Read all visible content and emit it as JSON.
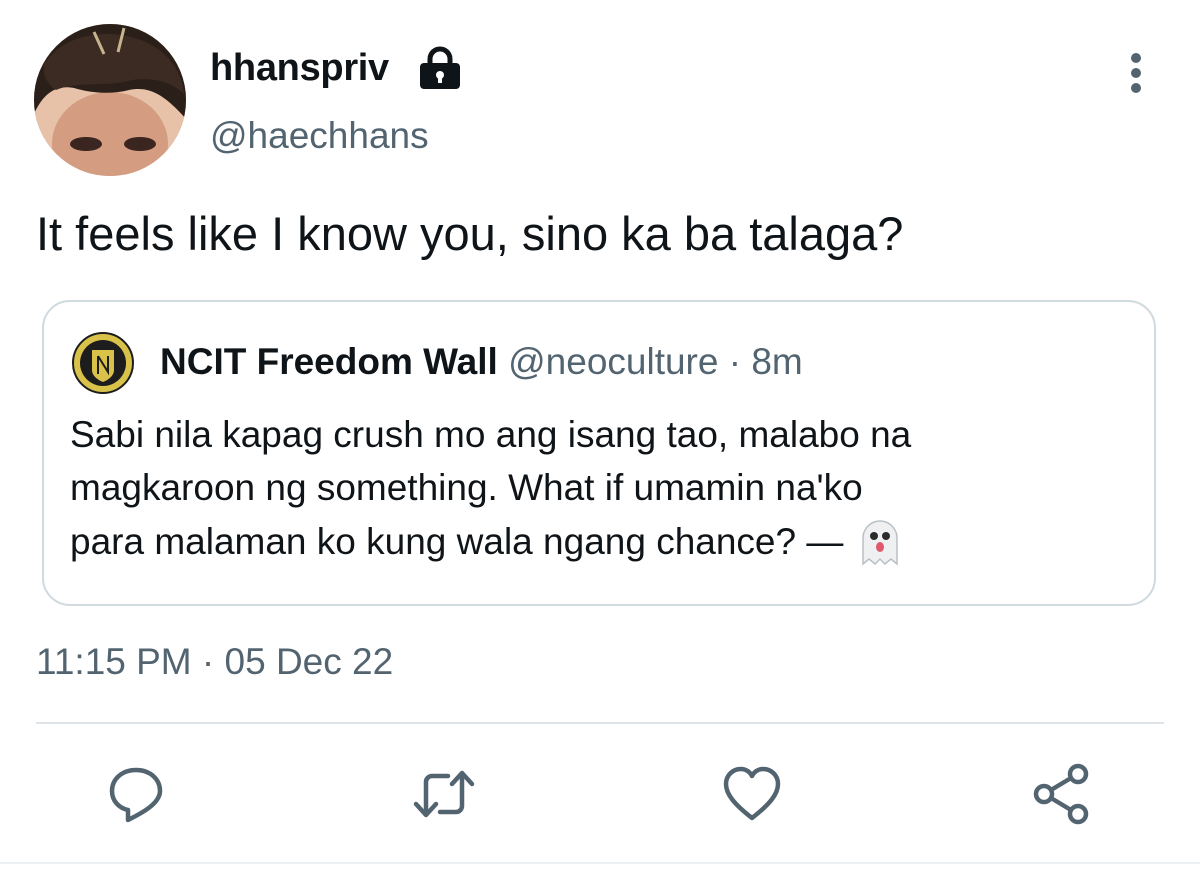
{
  "author": {
    "display_name": "hhanspriv",
    "username": "@haechhans",
    "protected_icon": "lock-icon"
  },
  "tweet": {
    "text": "It feels like I know you, sino ka ba talaga?"
  },
  "quoted_tweet": {
    "display_name": "NCIT Freedom Wall",
    "username": "@neoculture",
    "age": "8m",
    "lines": [
      "Sabi nila kapag crush mo ang isang tao, malabo na",
      "magkaroon ng something. What if umamin na'ko",
      "para malaman ko kung wala ngang chance? —"
    ],
    "emoji": "ghost-emoji"
  },
  "meta": {
    "time": "11:15 PM",
    "date": "05 Dec 22"
  },
  "actions": [
    "reply-icon",
    "retweet-icon",
    "like-icon",
    "share-icon"
  ],
  "colors": {
    "text_primary": "#0f1419",
    "text_secondary": "#536471",
    "border": "#cfd9de"
  }
}
